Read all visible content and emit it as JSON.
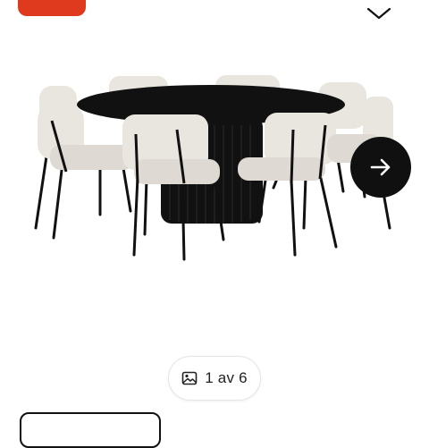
{
  "colors": {
    "accent": "#e03a1e",
    "table": "#111111",
    "upholstery": "#e9e5df",
    "chair_frame": "#111111",
    "nav_button": "#101010"
  },
  "header": {
    "promo_badge": "",
    "collapse_icon": "chevron-down-icon"
  },
  "gallery": {
    "image_alt": "",
    "next_icon": "arrow-right-icon",
    "counter_icon": "image-icon",
    "counter_text": "1 av 6",
    "current": 1,
    "total": 6
  },
  "footer": {
    "button_label": ""
  }
}
